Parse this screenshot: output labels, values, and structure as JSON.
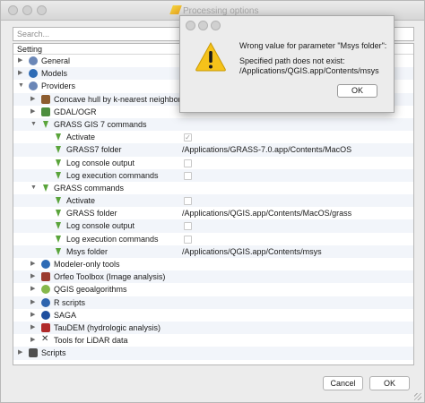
{
  "window": {
    "title": "Processing options"
  },
  "search": {
    "placeholder": "Search..."
  },
  "tree": {
    "header": "Setting",
    "rows": [
      {
        "label": "General"
      },
      {
        "label": "Models"
      },
      {
        "label": "Providers"
      },
      {
        "label": "Concave hull by k-nearest neighbors"
      },
      {
        "label": "GDAL/OGR"
      },
      {
        "label": "GRASS GIS 7 commands"
      },
      {
        "label": "Activate",
        "checked": true
      },
      {
        "label": "GRASS7 folder",
        "value": "/Applications/GRASS-7.0.app/Contents/MacOS"
      },
      {
        "label": "Log console output",
        "checked": false
      },
      {
        "label": "Log execution commands",
        "checked": false
      },
      {
        "label": "GRASS commands"
      },
      {
        "label": "Activate",
        "checked": false
      },
      {
        "label": "GRASS folder",
        "value": "/Applications/QGIS.app/Contents/MacOS/grass"
      },
      {
        "label": "Log console output",
        "checked": false
      },
      {
        "label": "Log execution commands",
        "checked": false
      },
      {
        "label": "Msys folder",
        "value": "/Applications/QGIS.app/Contents/msys"
      },
      {
        "label": "Modeler-only tools"
      },
      {
        "label": "Orfeo Toolbox (Image analysis)"
      },
      {
        "label": "QGIS geoalgorithms"
      },
      {
        "label": "R scripts"
      },
      {
        "label": "SAGA"
      },
      {
        "label": "TauDEM (hydrologic analysis)"
      },
      {
        "label": "Tools for LiDAR data"
      },
      {
        "label": "Scripts"
      }
    ]
  },
  "buttons": {
    "cancel": "Cancel",
    "ok": "OK"
  },
  "alert": {
    "title": "Wrong value for parameter \"Msys folder\":",
    "message_line1": "Specified path does not exist:",
    "message_line2": "/Applications/QGIS.app/Contents/msys",
    "ok": "OK"
  }
}
